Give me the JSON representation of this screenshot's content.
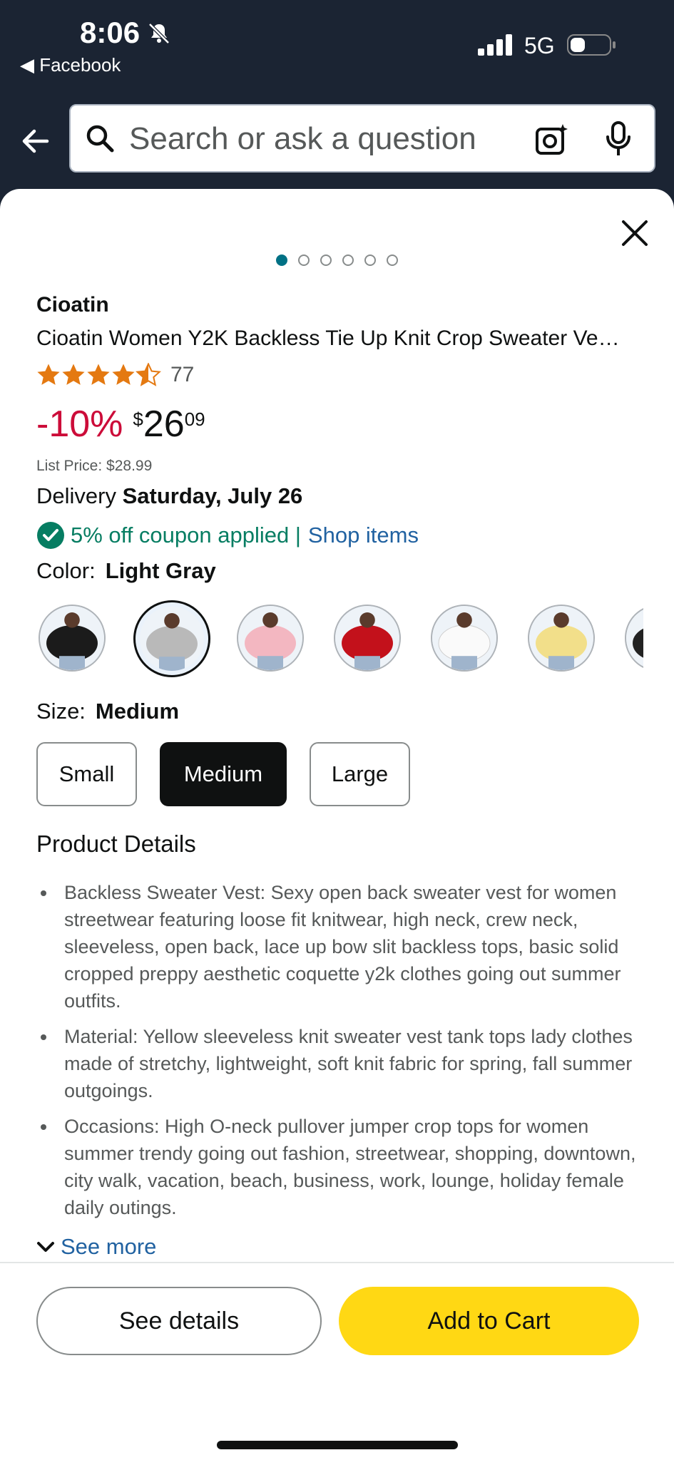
{
  "status": {
    "time": "8:06",
    "back_app": "Facebook",
    "network": "5G"
  },
  "search": {
    "placeholder": "Search or ask a question"
  },
  "carousel": {
    "count": 6,
    "active": 0
  },
  "product": {
    "brand": "Cioatin",
    "title": "Cioatin Women Y2K Backless Tie Up Knit Crop Sweater Ve…",
    "rating": 4.5,
    "rating_count": "77",
    "discount": "-10%",
    "currency": "$",
    "price_whole": "26",
    "price_fraction": "09",
    "list_price": "List Price: $28.99",
    "delivery_label": "Delivery",
    "delivery_date": "Saturday, July 26",
    "coupon_text": "5% off coupon applied |",
    "coupon_link": "Shop items"
  },
  "color": {
    "label": "Color:",
    "selected": "Light Gray",
    "swatches": [
      {
        "name": "black",
        "color": "#1b1b1b"
      },
      {
        "name": "light-gray",
        "color": "#b9b9b9"
      },
      {
        "name": "pink",
        "color": "#f3b7c1"
      },
      {
        "name": "red",
        "color": "#c3111b"
      },
      {
        "name": "white",
        "color": "#f4f4f4"
      },
      {
        "name": "yellow",
        "color": "#f2df8a"
      },
      {
        "name": "more",
        "color": "#222222"
      }
    ]
  },
  "size": {
    "label": "Size:",
    "selected": "Medium",
    "options": [
      "Small",
      "Medium",
      "Large"
    ]
  },
  "details": {
    "heading": "Product Details",
    "bullets": [
      "Backless Sweater Vest: Sexy open back sweater vest for women streetwear featuring loose fit knitwear, high neck, crew neck, sleeveless, open back, lace up bow slit backless tops, basic solid cropped preppy aesthetic coquette y2k clothes going out summer outfits.",
      "Material: Yellow sleeveless knit sweater vest tank tops lady clothes made of stretchy, lightweight, soft knit fabric for spring, fall summer outgoings.",
      "Occasions: High O-neck pullover jumper crop tops for women summer trendy going out fashion, streetwear, shopping, downtown, city walk, vacation, beach, business, work, lounge, holiday female daily outings."
    ],
    "see_more": "See more"
  },
  "actions": {
    "details": "See details",
    "cart": "Add to Cart"
  },
  "colors": {
    "accent": "#ffd814",
    "discount": "#cc0c39",
    "link": "#2162a1",
    "success": "#067d62",
    "star": "#e47911",
    "header": "#1b2433"
  }
}
